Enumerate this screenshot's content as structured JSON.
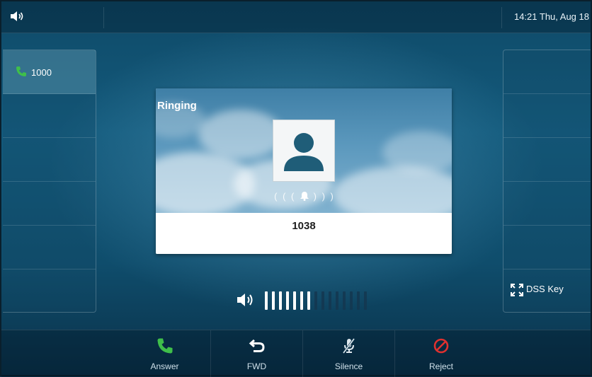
{
  "status_bar": {
    "clock": "14:21 Thu, Aug 18",
    "volume_icon": "speaker-icon"
  },
  "left_panel": {
    "lines": [
      {
        "label": "1000",
        "icon": "phone-icon",
        "active": true
      }
    ]
  },
  "right_panel": {
    "dss_key_label": "DSS Key",
    "dss_icon": "expand-icon"
  },
  "call": {
    "state": "Ringing",
    "number": "1038",
    "avatar_icon": "person-icon",
    "ring_icon": "bell-icon"
  },
  "volume": {
    "level": 7,
    "max": 15,
    "icon": "speaker-icon"
  },
  "softkeys": [
    {
      "label": "Answer",
      "icon": "phone-answer-icon",
      "color": "#3fbf4a"
    },
    {
      "label": "FWD",
      "icon": "forward-icon",
      "color": "#ffffff"
    },
    {
      "label": "Silence",
      "icon": "mic-mute-icon",
      "color": "#dfe8ee"
    },
    {
      "label": "Reject",
      "icon": "reject-icon",
      "color": "#e0312f"
    }
  ],
  "colors": {
    "accent_green": "#3fbf4a",
    "reject_red": "#e0312f",
    "avatar_teal": "#1f5d78"
  }
}
